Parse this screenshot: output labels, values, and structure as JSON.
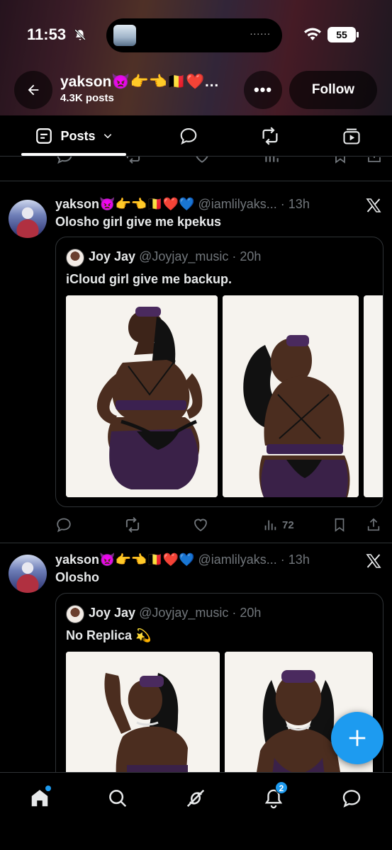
{
  "status_bar": {
    "time": "11:53",
    "battery": "55"
  },
  "profile": {
    "name": "yakson👿👉👈🇧🇪❤️…",
    "posts_count": "4.3K posts",
    "follow_label": "Follow"
  },
  "tabs": {
    "posts_label": "Posts"
  },
  "tweets": [
    {
      "author": "yakson👿👉👈🇧🇪❤️💙",
      "handle_time": " @iamlilyaks... · 13h",
      "text": "Olosho girl give me kpekus",
      "quote": {
        "name": "Joy Jay",
        "handle_time": " @Joyjay_music · 20h",
        "text": "iCloud girl give me backup."
      },
      "views": "72"
    },
    {
      "author": "yakson👿👉👈🇧🇪❤️💙",
      "handle_time": " @iamlilyaks... · 13h",
      "text": "Olosho",
      "quote": {
        "name": "Joy Jay",
        "handle_time": " @Joyjay_music · 20h",
        "text": "No Replica 💫"
      }
    }
  ],
  "bottom_nav": {
    "notifications_badge": "2"
  },
  "colors": {
    "accent": "#1d9bf0",
    "background": "#000000",
    "muted_text": "#71767b"
  }
}
